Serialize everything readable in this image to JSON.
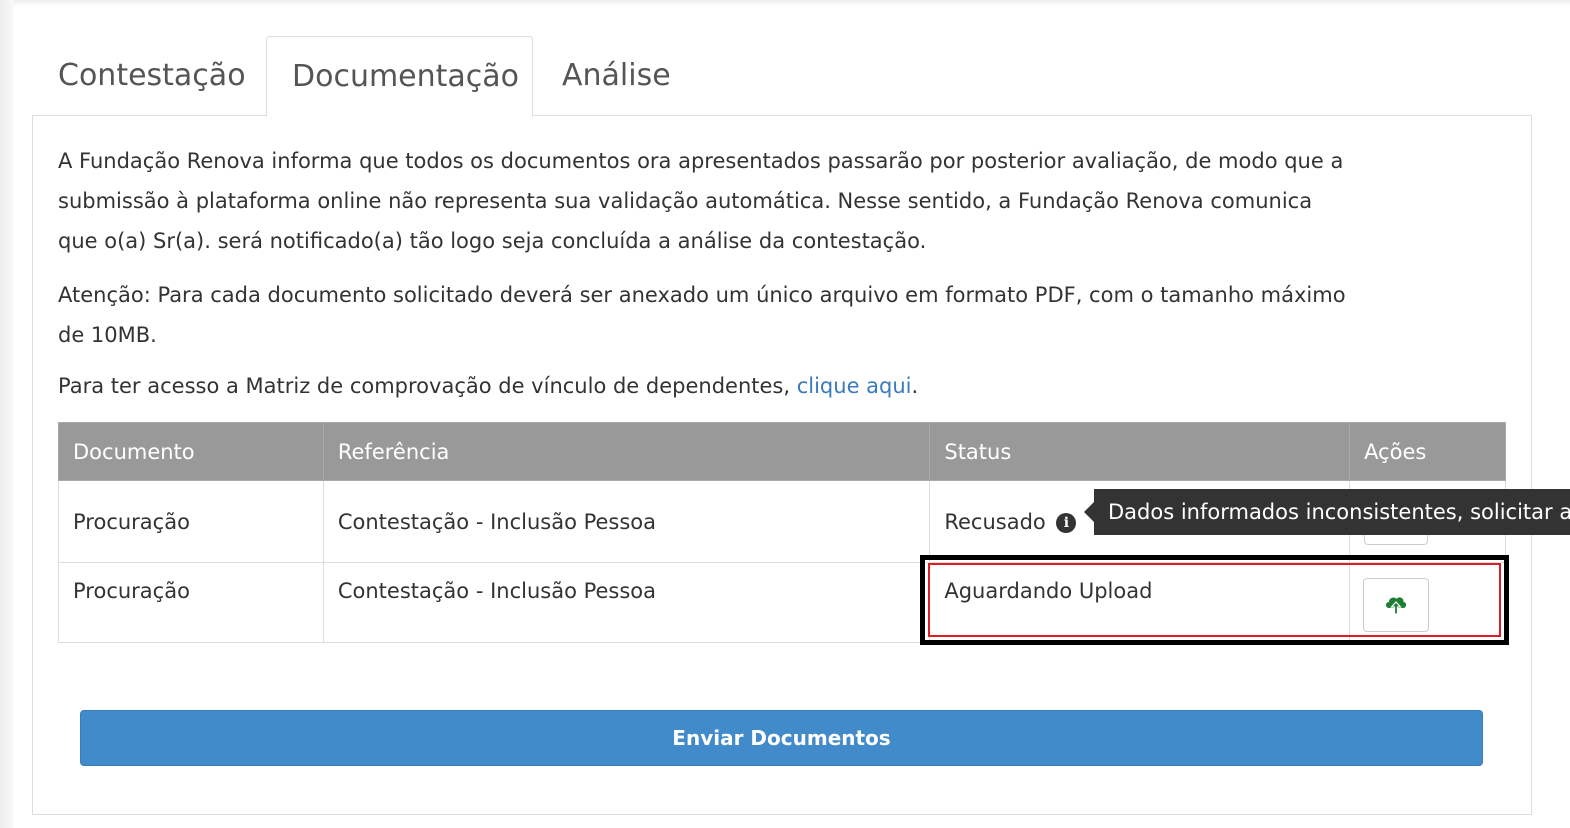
{
  "tabs": [
    {
      "label": "Contestação"
    },
    {
      "label": "Documentação"
    },
    {
      "label": "Análise"
    }
  ],
  "intro": {
    "line1": "A Fundação Renova informa que todos os documentos ora apresentados passarão por posterior avaliação, de modo que a",
    "line2": "submissão à plataforma online não representa sua validação automática. Nesse sentido, a Fundação Renova comunica",
    "line3": "que o(a) Sr(a). será notificado(a) tão logo seja concluída a análise da contestação."
  },
  "attention": {
    "line1": "Atenção: Para cada documento solicitado deverá ser anexado um único arquivo em formato PDF, com o tamanho máximo",
    "line2": "de 10MB."
  },
  "matrix": {
    "text": "Para ter acesso a Matriz de comprovação de vínculo de dependentes, ",
    "link": "clique aqui",
    "suffix": "."
  },
  "table": {
    "headers": [
      "Documento",
      "Referência",
      "Status",
      "Ações"
    ],
    "rows": [
      {
        "documento": "Procuração",
        "referencia": "Contestação - Inclusão Pessoa",
        "status": "Recusado"
      },
      {
        "documento": "Procuração",
        "referencia": "Contestação - Inclusão Pessoa",
        "status": "Aguardando Upload"
      }
    ]
  },
  "tooltip": {
    "text": "Dados informados inconsistentes, solicitar atu"
  },
  "icons": {
    "info": "info-circle-icon",
    "upload": "cloud-upload-icon"
  },
  "colors": {
    "accent": "#428bca",
    "link": "#3a7bbf",
    "upload_icon": "#1e7e34",
    "highlight_outer": "#000000",
    "highlight_inner": "#e01b24"
  },
  "footer": {
    "send_label": "Enviar Documentos"
  }
}
